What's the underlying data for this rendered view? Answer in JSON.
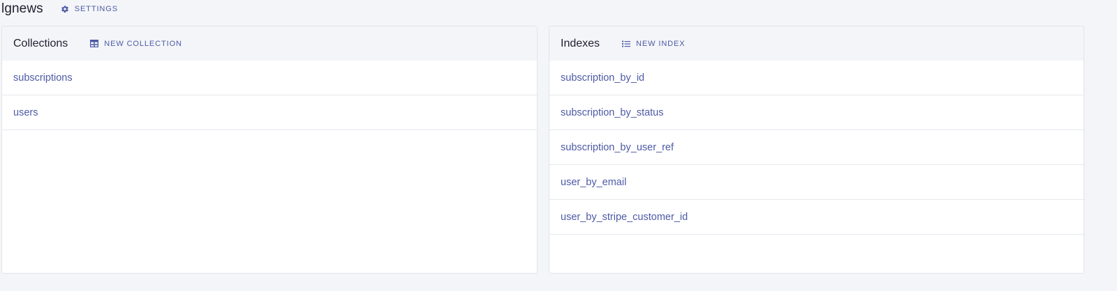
{
  "header": {
    "title": "lgnews",
    "settings_label": "SETTINGS"
  },
  "collections": {
    "title": "Collections",
    "new_label": "NEW COLLECTION",
    "items": [
      {
        "label": "subscriptions"
      },
      {
        "label": "users"
      }
    ]
  },
  "indexes": {
    "title": "Indexes",
    "new_label": "NEW INDEX",
    "items": [
      {
        "label": "subscription_by_id"
      },
      {
        "label": "subscription_by_status"
      },
      {
        "label": "subscription_by_user_ref"
      },
      {
        "label": "user_by_email"
      },
      {
        "label": "user_by_stripe_customer_id"
      }
    ]
  },
  "colors": {
    "accent": "#4d5aa6",
    "background": "#f4f5f8",
    "panel": "#ffffff",
    "text": "#1e2130"
  },
  "icons": {
    "settings": "gear-icon",
    "new_collection": "table-icon",
    "new_index": "list-icon"
  }
}
